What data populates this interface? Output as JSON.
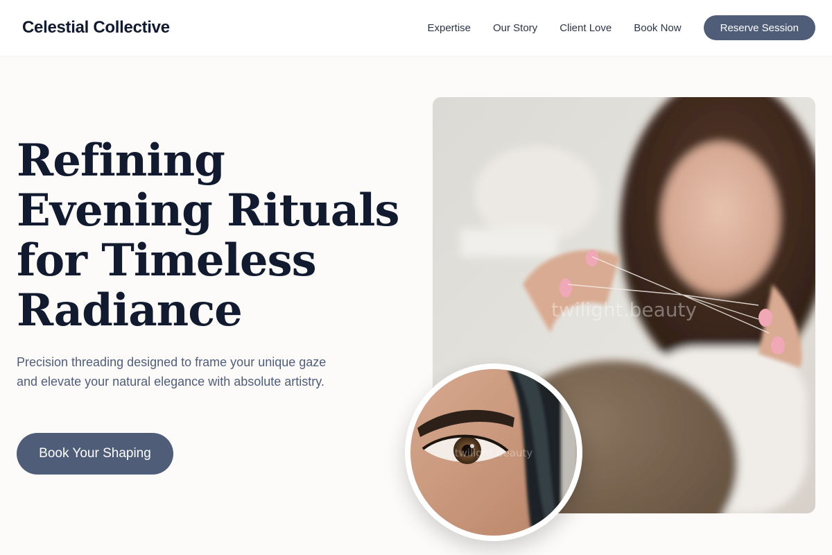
{
  "header": {
    "brand": "Celestial Collective",
    "nav": [
      {
        "label": "Expertise"
      },
      {
        "label": "Our Story"
      },
      {
        "label": "Client Love"
      },
      {
        "label": "Book Now"
      }
    ],
    "cta_label": "Reserve Session"
  },
  "hero": {
    "title_lines": [
      "Refining",
      "Evening Rituals",
      "for Timeless",
      "Radiance"
    ],
    "subtitle": "Precision threading designed to frame your unique gaze and elevate your natural elegance with absolute artistry.",
    "cta_label": "Book Your Shaping"
  },
  "images": {
    "main_watermark": "twilight.beauty",
    "inset_watermark": "twilight.beauty"
  },
  "colors": {
    "accent": "#4f5d79",
    "heading": "#111a2e",
    "body_text": "#4f5d79",
    "background": "#fcfbfa"
  }
}
